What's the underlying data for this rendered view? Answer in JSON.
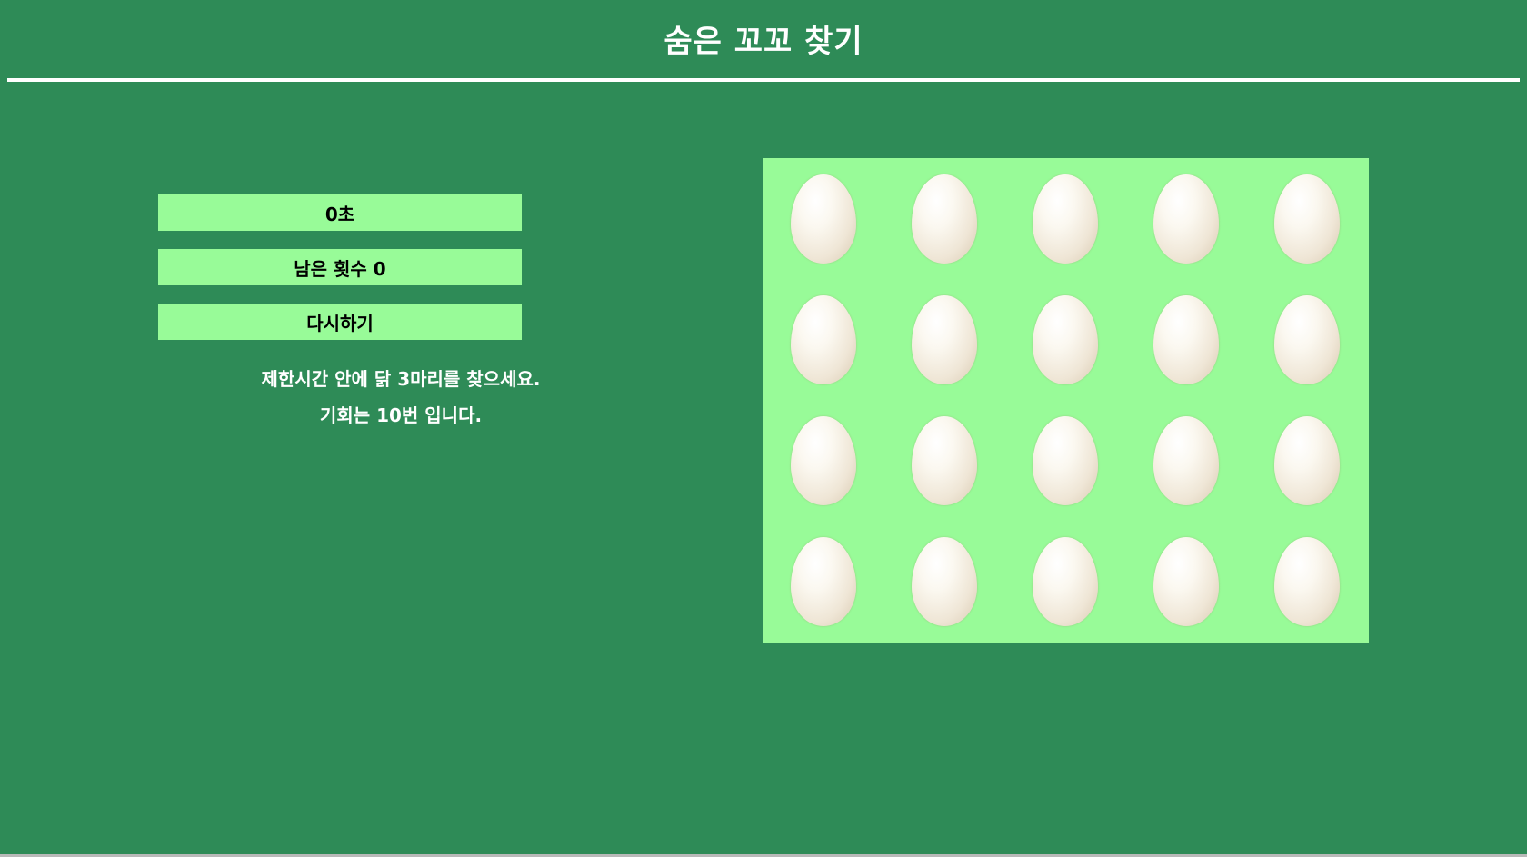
{
  "header": {
    "title": "숨은 꼬꼬 찾기"
  },
  "status": {
    "timer_label": "0초",
    "remaining_label": "남은 횟수 0",
    "restart_label": "다시하기"
  },
  "instructions": {
    "line1": "제한시간 안에 닭 3마리를 찾으세요.",
    "line2": "기회는 10번 입니다."
  },
  "board": {
    "rows": 4,
    "cols": 5,
    "egg_icon": "egg-icon"
  },
  "colors": {
    "background": "#2e8b57",
    "panel": "#98fb98",
    "text_light": "#ffffff",
    "text_dark": "#000000"
  }
}
